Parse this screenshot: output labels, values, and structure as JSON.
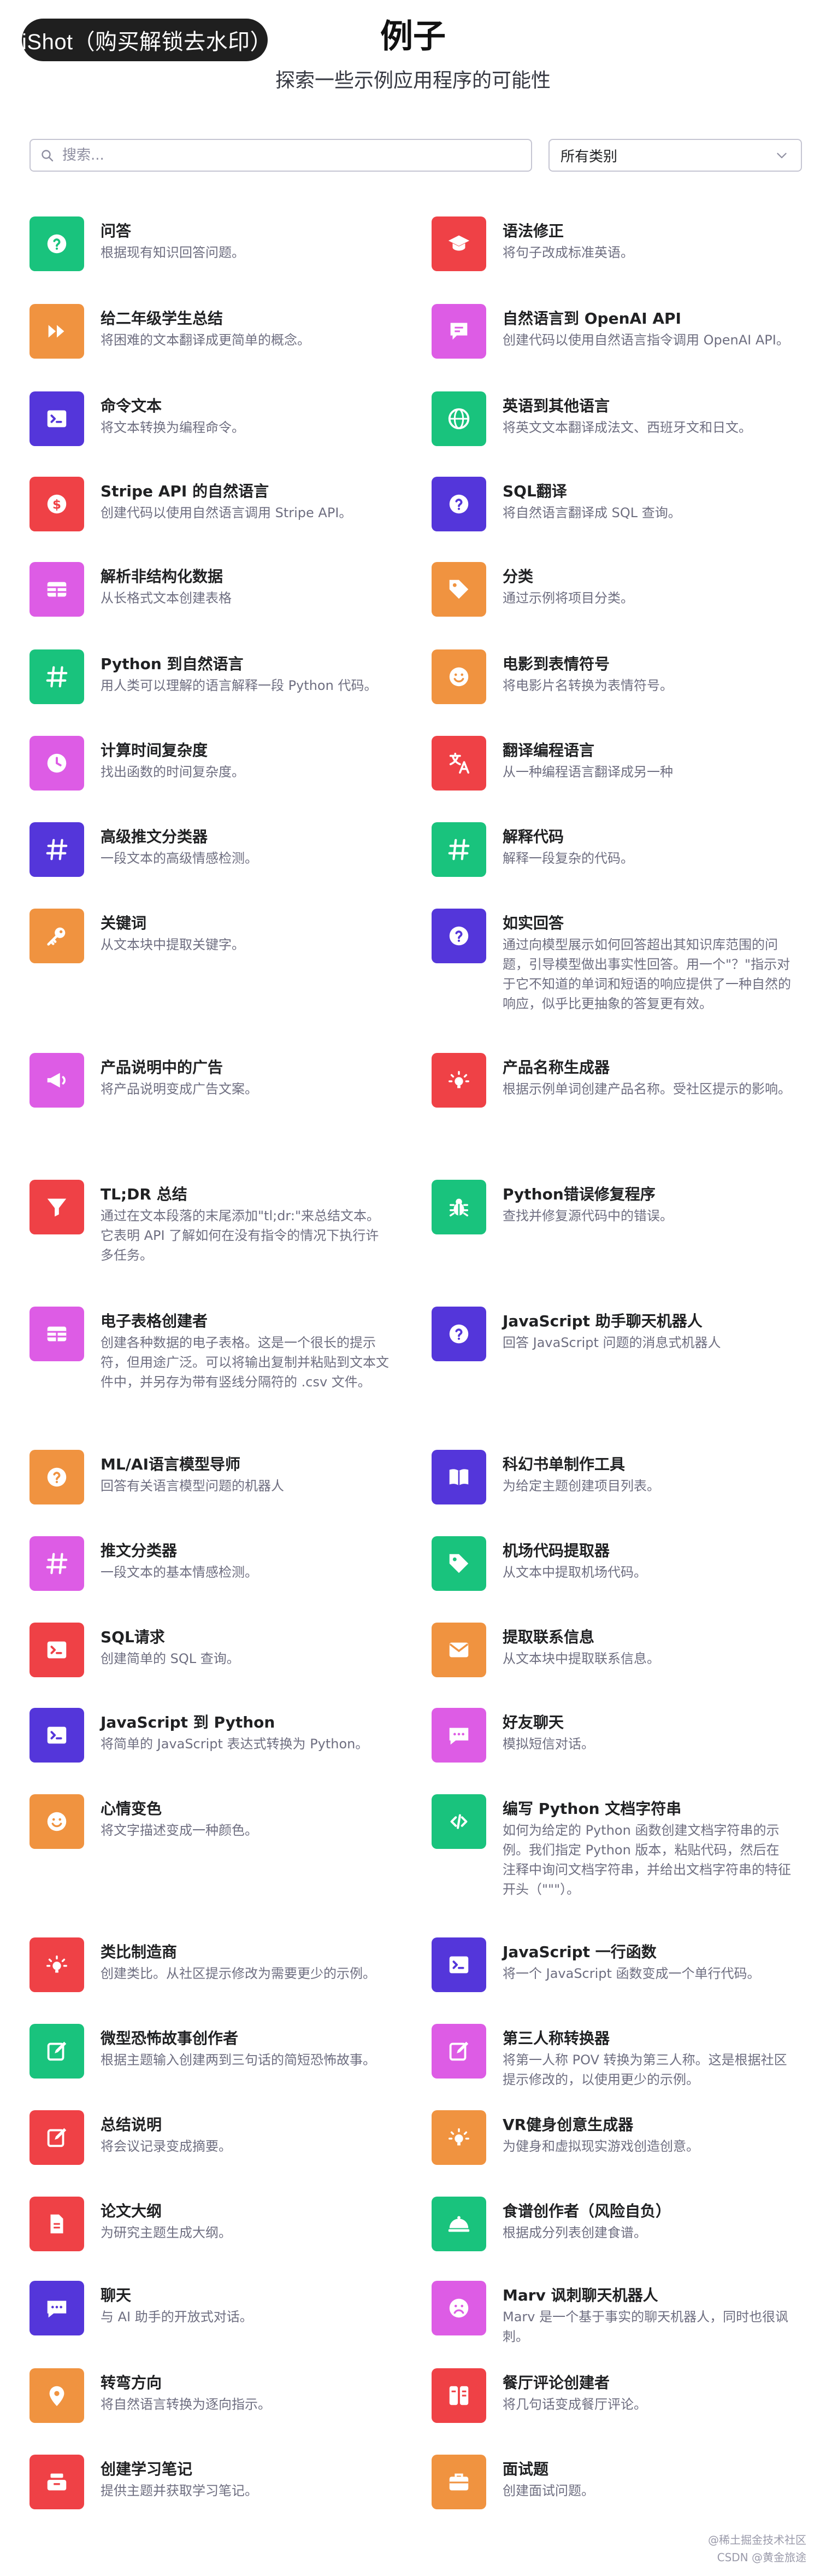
{
  "watermark": "iShot（购买解锁去水印）",
  "header": {
    "title": "例子",
    "subtitle": "探索一些示例应用程序的可能性"
  },
  "search": {
    "placeholder": "搜索..."
  },
  "filter": {
    "selected": "所有类别"
  },
  "colors": {
    "green": "#19c37d",
    "orange": "#f09340",
    "purple": "#5436da",
    "red": "#ef4146",
    "magenta": "#dd5ce5"
  },
  "left_items": [
    {
      "title": "问答",
      "desc": "根据现有知识回答问题。",
      "color": "#19c37d",
      "icon": "question-icon"
    },
    {
      "title": "给二年级学生总结",
      "desc": "将困难的文本翻译成更简单的概念。",
      "color": "#f09340",
      "icon": "fast-forward-icon"
    },
    {
      "title": "命令文本",
      "desc": "将文本转换为编程命令。",
      "color": "#5436da",
      "icon": "terminal-icon"
    },
    {
      "title": "Stripe API 的自然语言",
      "desc": "创建代码以使用自然语言调用 Stripe API。",
      "color": "#ef4146",
      "icon": "dollar-icon"
    },
    {
      "title": "解析非结构化数据",
      "desc": "从长格式文本创建表格",
      "color": "#dd5ce5",
      "icon": "table-icon"
    },
    {
      "title": "Python 到自然语言",
      "desc": "用人类可以理解的语言解释一段 Python 代码。",
      "color": "#19c37d",
      "icon": "hash-icon"
    },
    {
      "title": "计算时间复杂度",
      "desc": "找出函数的时间复杂度。",
      "color": "#dd5ce5",
      "icon": "clock-icon"
    },
    {
      "title": "高级推文分类器",
      "desc": "一段文本的高级情感检测。",
      "color": "#5436da",
      "icon": "hash-icon"
    },
    {
      "title": "关键词",
      "desc": "从文本块中提取关键字。",
      "color": "#f09340",
      "icon": "key-icon"
    },
    {
      "title": "产品说明中的广告",
      "desc": "将产品说明变成广告文案。",
      "color": "#dd5ce5",
      "icon": "megaphone-icon"
    },
    {
      "title": "TL;DR 总结",
      "desc": "通过在文本段落的末尾添加\"tl;dr:\"来总结文本。它表明 API 了解如何在没有指令的情况下执行许多任务。",
      "color": "#ef4146",
      "icon": "filter-icon"
    },
    {
      "title": "电子表格创建者",
      "desc": "创建各种数据的电子表格。这是一个很长的提示符，但用途广泛。可以将输出复制并粘贴到文本文件中，并另存为带有竖线分隔符的 .csv 文件。",
      "color": "#dd5ce5",
      "icon": "table-icon"
    },
    {
      "title": "ML/AI语言模型导师",
      "desc": "回答有关语言模型问题的机器人",
      "color": "#f09340",
      "icon": "question-icon"
    },
    {
      "title": "推文分类器",
      "desc": "一段文本的基本情感检测。",
      "color": "#dd5ce5",
      "icon": "hash-icon"
    },
    {
      "title": "SQL请求",
      "desc": "创建简单的 SQL 查询。",
      "color": "#ef4146",
      "icon": "terminal-icon"
    },
    {
      "title": "JavaScript 到 Python",
      "desc": "将简单的 JavaScript 表达式转换为 Python。",
      "color": "#5436da",
      "icon": "terminal-icon"
    },
    {
      "title": "心情变色",
      "desc": "将文字描述变成一种颜色。",
      "color": "#f09340",
      "icon": "smile-icon"
    },
    {
      "title": "类比制造商",
      "desc": "创建类比。从社区提示修改为需要更少的示例。",
      "color": "#ef4146",
      "icon": "bulb-icon"
    },
    {
      "title": "微型恐怖故事创作者",
      "desc": "根据主题输入创建两到三句话的简短恐怖故事。",
      "color": "#19c37d",
      "icon": "edit-icon"
    },
    {
      "title": "总结说明",
      "desc": "将会议记录变成摘要。",
      "color": "#ef4146",
      "icon": "edit-icon"
    },
    {
      "title": "论文大纲",
      "desc": "为研究主题生成大纲。",
      "color": "#ef4146",
      "icon": "document-icon"
    },
    {
      "title": "聊天",
      "desc": "与 AI 助手的开放式对话。",
      "color": "#5436da",
      "icon": "chat-icon"
    },
    {
      "title": "转弯方向",
      "desc": "将自然语言转换为逐向指示。",
      "color": "#f09340",
      "icon": "pin-icon"
    },
    {
      "title": "创建学习笔记",
      "desc": "提供主题并获取学习笔记。",
      "color": "#ef4146",
      "icon": "tray-icon"
    }
  ],
  "right_items": [
    {
      "title": "语法修正",
      "desc": "将句子改成标准英语。",
      "color": "#ef4146",
      "icon": "graduation-cap-icon"
    },
    {
      "title": "自然语言到 OpenAI API",
      "desc": "创建代码以使用自然语言指令调用 OpenAI API。",
      "color": "#dd5ce5",
      "icon": "message-icon"
    },
    {
      "title": "英语到其他语言",
      "desc": "将英文文本翻译成法文、西班牙文和日文。",
      "color": "#19c37d",
      "icon": "globe-icon"
    },
    {
      "title": "SQL翻译",
      "desc": "将自然语言翻译成 SQL 查询。",
      "color": "#5436da",
      "icon": "question-icon"
    },
    {
      "title": "分类",
      "desc": "通过示例将项目分类。",
      "color": "#f09340",
      "icon": "tag-icon"
    },
    {
      "title": "电影到表情符号",
      "desc": "将电影片名转换为表情符号。",
      "color": "#f09340",
      "icon": "smile-icon"
    },
    {
      "title": "翻译编程语言",
      "desc": "从一种编程语言翻译成另一种",
      "color": "#ef4146",
      "icon": "translate-icon"
    },
    {
      "title": "解释代码",
      "desc": "解释一段复杂的代码。",
      "color": "#19c37d",
      "icon": "hash-icon"
    },
    {
      "title": "如实回答",
      "desc": "通过向模型展示如何回答超出其知识库范围的问题，引导模型做出事实性回答。用一个\"？\"指示对于它不知道的单词和短语的响应提供了一种自然的响应，似乎比更抽象的答复更有效。",
      "color": "#5436da",
      "icon": "question-icon"
    },
    {
      "title": "产品名称生成器",
      "desc": "根据示例单词创建产品名称。受社区提示的影响。",
      "color": "#ef4146",
      "icon": "bulb-icon"
    },
    {
      "title": "Python错误修复程序",
      "desc": "查找并修复源代码中的错误。",
      "color": "#19c37d",
      "icon": "bug-icon"
    },
    {
      "title": "JavaScript 助手聊天机器人",
      "desc": "回答 JavaScript 问题的消息式机器人",
      "color": "#5436da",
      "icon": "question-icon"
    },
    {
      "title": "科幻书单制作工具",
      "desc": "为给定主题创建项目列表。",
      "color": "#5436da",
      "icon": "book-icon"
    },
    {
      "title": "机场代码提取器",
      "desc": "从文本中提取机场代码。",
      "color": "#19c37d",
      "icon": "tag-icon"
    },
    {
      "title": "提取联系信息",
      "desc": "从文本块中提取联系信息。",
      "color": "#f09340",
      "icon": "mail-icon"
    },
    {
      "title": "好友聊天",
      "desc": "模拟短信对话。",
      "color": "#dd5ce5",
      "icon": "chat-icon"
    },
    {
      "title": "编写 Python 文档字符串",
      "desc": "如何为给定的 Python 函数创建文档字符串的示例。我们指定 Python 版本，粘贴代码，然后在注释中询问文档字符串，并给出文档字符串的特征开头（\"\"\"）。",
      "color": "#19c37d",
      "icon": "code-icon"
    },
    {
      "title": "JavaScript 一行函数",
      "desc": "将一个 JavaScript 函数变成一个单行代码。",
      "color": "#5436da",
      "icon": "terminal-icon"
    },
    {
      "title": "第三人称转换器",
      "desc": "将第一人称 POV 转换为第三人称。这是根据社区提示修改的，以使用更少的示例。",
      "color": "#dd5ce5",
      "icon": "edit-icon"
    },
    {
      "title": "VR健身创意生成器",
      "desc": "为健身和虚拟现实游戏创造创意。",
      "color": "#f09340",
      "icon": "bulb-icon"
    },
    {
      "title": "食谱创作者（风险自负）",
      "desc": "根据成分列表创建食谱。",
      "color": "#19c37d",
      "icon": "dish-icon"
    },
    {
      "title": "Marv 讽刺聊天机器人",
      "desc": "Marv 是一个基于事实的聊天机器人，同时也很讽刺。",
      "color": "#dd5ce5",
      "icon": "frown-icon"
    },
    {
      "title": "餐厅评论创建者",
      "desc": "将几句话变成餐厅评论。",
      "color": "#ef4146",
      "icon": "review-icon"
    },
    {
      "title": "面试题",
      "desc": "创建面试问题。",
      "color": "#f09340",
      "icon": "briefcase-icon"
    }
  ],
  "footer": {
    "line1": "@稀土掘金技术社区",
    "line2": "CSDN @黄金旅途"
  }
}
